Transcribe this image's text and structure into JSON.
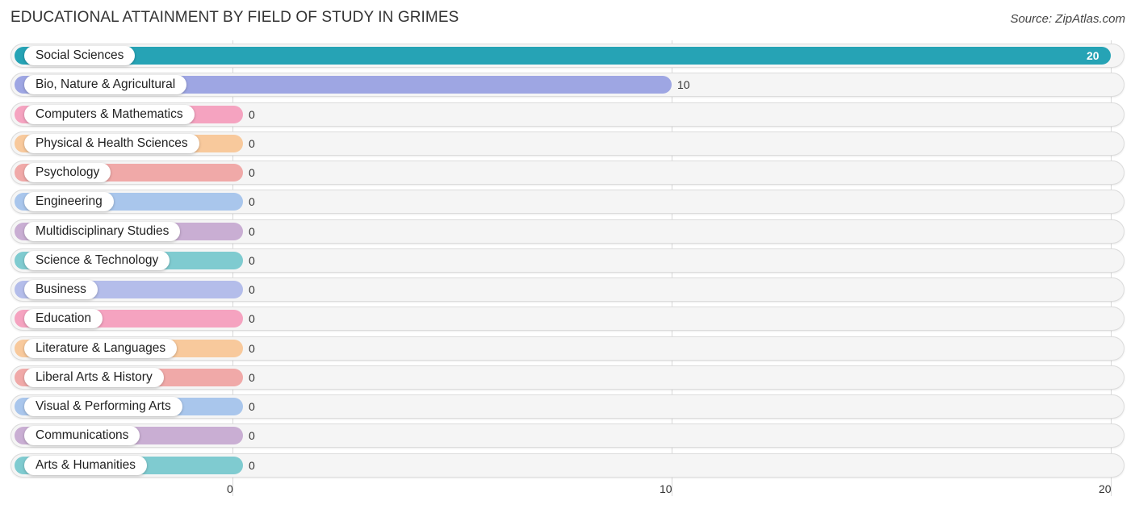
{
  "title": "EDUCATIONAL ATTAINMENT BY FIELD OF STUDY IN GRIMES",
  "source": "Source: ZipAtlas.com",
  "chart_data": {
    "type": "bar",
    "orientation": "horizontal",
    "title": "EDUCATIONAL ATTAINMENT BY FIELD OF STUDY IN GRIMES",
    "xlabel": "",
    "ylabel": "",
    "xlim": [
      0,
      20
    ],
    "xticks": [
      "0",
      "10",
      "20"
    ],
    "grid": true,
    "categories": [
      "Social Sciences",
      "Bio, Nature & Agricultural",
      "Computers & Mathematics",
      "Physical & Health Sciences",
      "Psychology",
      "Engineering",
      "Multidisciplinary Studies",
      "Science & Technology",
      "Business",
      "Education",
      "Literature & Languages",
      "Liberal Arts & History",
      "Visual & Performing Arts",
      "Communications",
      "Arts & Humanities"
    ],
    "values": [
      20,
      10,
      0,
      0,
      0,
      0,
      0,
      0,
      0,
      0,
      0,
      0,
      0,
      0,
      0
    ],
    "value_labels": [
      "20",
      "10",
      "0",
      "0",
      "0",
      "0",
      "0",
      "0",
      "0",
      "0",
      "0",
      "0",
      "0",
      "0",
      "0"
    ],
    "colors": [
      "#26a3b5",
      "#9ea6e3",
      "#f5a3c0",
      "#f8c99c",
      "#f0a9a8",
      "#a9c6ec",
      "#c9aed3",
      "#7fcbd0",
      "#b4bdea",
      "#f5a3c0",
      "#f8c99c",
      "#f0a9a8",
      "#a9c6ec",
      "#c9aed3",
      "#7fcbd0"
    ]
  }
}
